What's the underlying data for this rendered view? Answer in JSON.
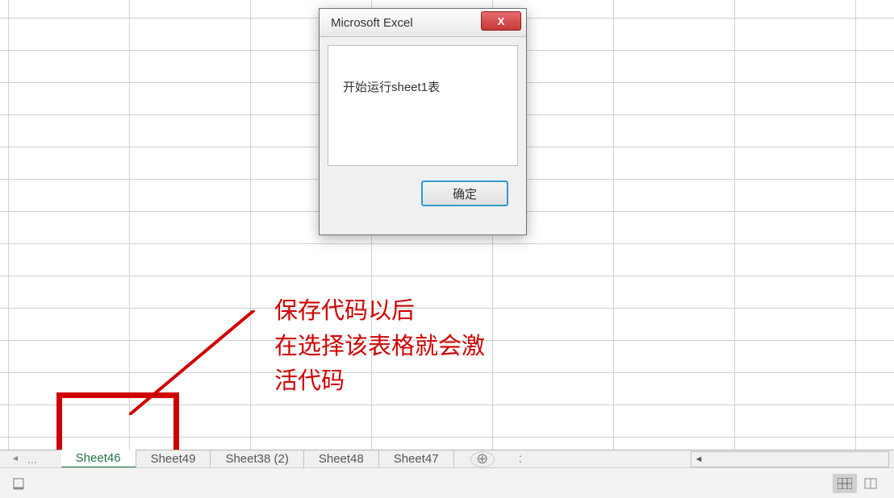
{
  "dialog": {
    "title": "Microsoft Excel",
    "message": "开始运行sheet1表",
    "ok_label": "确定",
    "close_label": "X"
  },
  "annotation": {
    "line1": "保存代码以后",
    "line2": "在选择该表格就会激",
    "line3": "活代码"
  },
  "tabs": {
    "nav_dots": "...",
    "items": [
      {
        "label": "Sheet46",
        "active": true
      },
      {
        "label": "Sheet49",
        "active": false
      },
      {
        "label": "Sheet38 (2)",
        "active": false
      },
      {
        "label": "Sheet48",
        "active": false
      },
      {
        "label": "Sheet47",
        "active": false
      }
    ],
    "add_label": "⊕",
    "more_label": ":"
  },
  "scrollbar": {
    "left_arrow": "◄"
  }
}
